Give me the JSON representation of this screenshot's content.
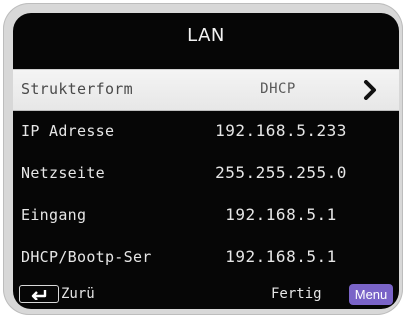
{
  "header": {
    "title": "LAN"
  },
  "rows": [
    {
      "label": "Strukterform",
      "value": "DHCP",
      "selected": true
    },
    {
      "label": "IP Adresse",
      "value": "192.168.5.233"
    },
    {
      "label": "Netzseite",
      "value": "255.255.255.0"
    },
    {
      "label": "Eingang",
      "value": "192.168.5.1"
    },
    {
      "label": "DHCP/Bootp-Ser",
      "value": "192.168.5.1"
    }
  ],
  "footer": {
    "back_label": "Zurü",
    "done_label": "Fertig",
    "menu_label": "Menu",
    "back_icon": "return-arrow-icon"
  },
  "colors": {
    "screen_background": "#060606",
    "selected_row": "#f0f0f0",
    "menu_key": "#7a64c8"
  }
}
